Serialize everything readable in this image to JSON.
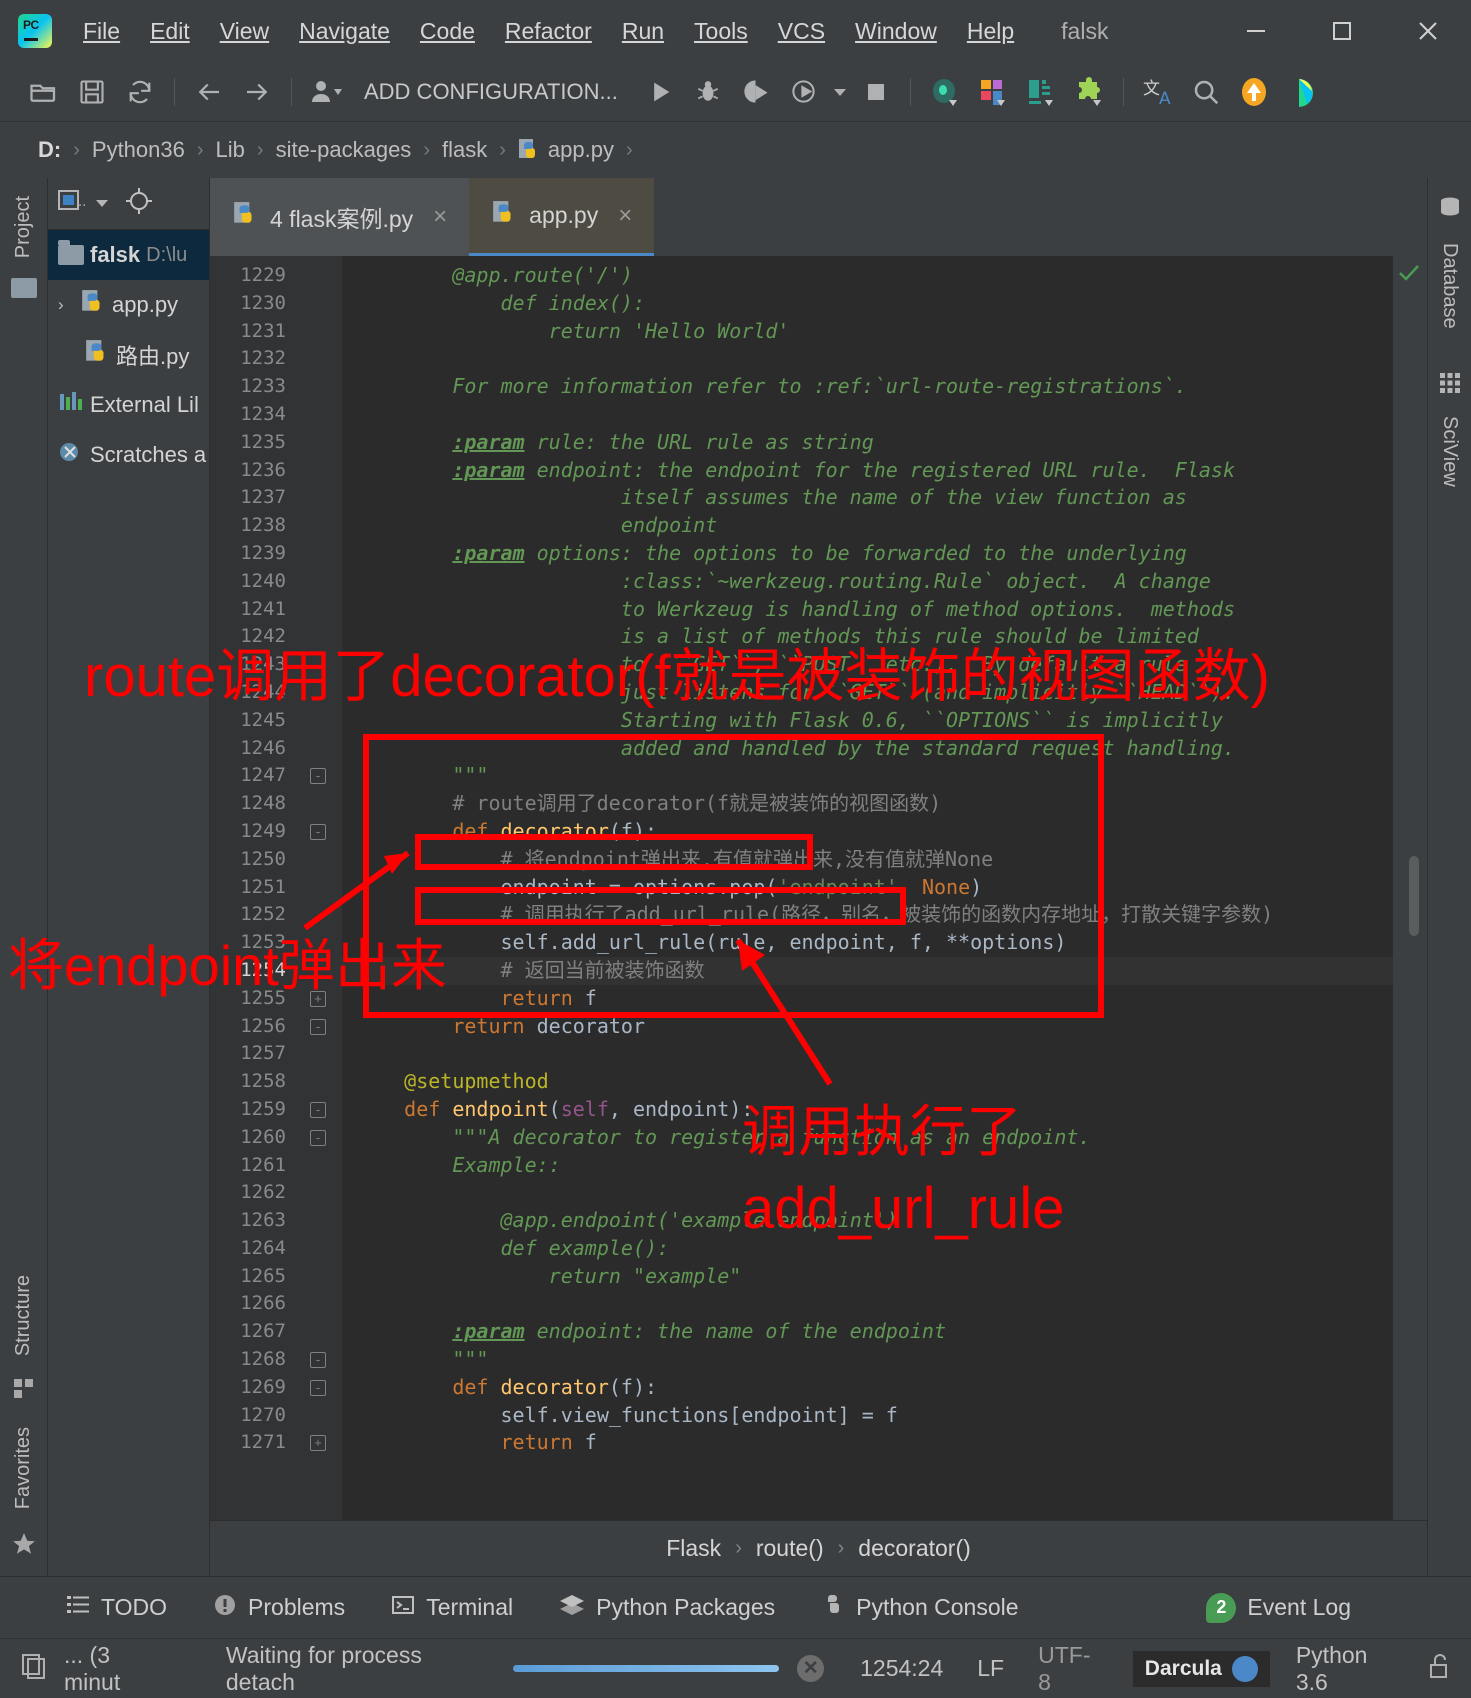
{
  "window": {
    "project_name": "falsk",
    "menu": [
      {
        "label": "File",
        "accel": "F"
      },
      {
        "label": "Edit",
        "accel": "E"
      },
      {
        "label": "View",
        "accel": "V"
      },
      {
        "label": "Navigate",
        "accel": "N"
      },
      {
        "label": "Code",
        "accel": "C"
      },
      {
        "label": "Refactor",
        "accel": "R"
      },
      {
        "label": "Run",
        "accel": "u"
      },
      {
        "label": "Tools",
        "accel": "T"
      },
      {
        "label": "VCS",
        "accel": "S"
      },
      {
        "label": "Window",
        "accel": "W"
      },
      {
        "label": "Help",
        "accel": "H"
      }
    ],
    "controls": {
      "minimize": "minimize-icon",
      "maximize": "maximize-icon",
      "close": "close-icon"
    }
  },
  "toolbar": {
    "run_config_label": "ADD CONFIGURATION...",
    "icons": [
      "open-folder-icon",
      "save-icon",
      "sync-icon",
      "back-arrow-icon",
      "forward-arrow-icon",
      "profile-dropdown-icon",
      "run-icon",
      "debug-icon",
      "run-with-coverage-icon",
      "profile-run-icon",
      "stop-icon",
      "search-everywhere-icon",
      "layout-icon",
      "data-view-icon",
      "plugins-icon",
      "translate-icon",
      "magnifier-icon",
      "update-icon",
      "ide-features-icon"
    ]
  },
  "breadcrumb": {
    "items": [
      "D:",
      "Python36",
      "Lib",
      "site-packages",
      "flask",
      "app.py"
    ]
  },
  "project_panel": {
    "title": "Project",
    "toolbar_icons": [
      "project-view-selector-icon",
      "scroll-from-source-icon"
    ],
    "tree": [
      {
        "name": "falsk",
        "path": "D:\\lu",
        "type": "folder",
        "selected": true,
        "bold": true
      },
      {
        "name": "app.py",
        "path": "",
        "type": "python",
        "arrow": "›"
      },
      {
        "name": "路由.py",
        "path": "",
        "type": "python"
      },
      {
        "name": "External Lil",
        "path": "",
        "type": "library"
      },
      {
        "name": "Scratches a",
        "path": "",
        "type": "scratch"
      }
    ]
  },
  "left_strip": {
    "tabs": [
      "Project",
      "Structure",
      "Favorites"
    ]
  },
  "right_strip": {
    "tabs": [
      "Database",
      "SciView"
    ]
  },
  "tabs": [
    {
      "label": "4 flask案例.py",
      "active": false,
      "close": "×"
    },
    {
      "label": "app.py",
      "active": true,
      "close": "×"
    }
  ],
  "editor": {
    "first_line": 1229,
    "current_line": 1254,
    "lines": [
      {
        "n": 1229,
        "html": "        <span class='doc'>@app.route('/')</span>"
      },
      {
        "n": 1230,
        "html": "            <span class='doc'>def index():</span>"
      },
      {
        "n": 1231,
        "html": "                <span class='doc'>return 'Hello World'</span>"
      },
      {
        "n": 1232,
        "html": ""
      },
      {
        "n": 1233,
        "html": "        <span class='doc'>For more information refer to :ref:`url-route-registrations`.</span>"
      },
      {
        "n": 1234,
        "html": ""
      },
      {
        "n": 1235,
        "html": "        <span class='docp'>:param</span><span class='doc'> rule: the URL rule as string</span>"
      },
      {
        "n": 1236,
        "html": "        <span class='docp'>:param</span><span class='doc'> endpoint: the endpoint for the registered URL rule.  Flask</span>"
      },
      {
        "n": 1237,
        "html": "                      <span class='doc'>itself assumes the name of the view function as</span>"
      },
      {
        "n": 1238,
        "html": "                      <span class='doc'>endpoint</span>"
      },
      {
        "n": 1239,
        "html": "        <span class='docp'>:param</span><span class='doc'> options: the options to be forwarded to the underlying</span>"
      },
      {
        "n": 1240,
        "html": "                      <span class='doc'>:class:`~werkzeug.routing.Rule` object.  A change</span>"
      },
      {
        "n": 1241,
        "html": "                      <span class='doc'>to Werkzeug is handling of method options.  methods</span>"
      },
      {
        "n": 1242,
        "html": "                      <span class='doc'>is a list of methods this rule should be limited</span>"
      },
      {
        "n": 1243,
        "html": "                      <span class='doc'>to (``GET``, ``POST`` etc.).  By default a rule</span>"
      },
      {
        "n": 1244,
        "html": "                      <span class='doc'>just listens for ``GET`` (and implicitly ``HEAD``).</span>"
      },
      {
        "n": 1245,
        "html": "                      <span class='doc'>Starting with Flask 0.6, ``OPTIONS`` is implicitly</span>"
      },
      {
        "n": 1246,
        "html": "                      <span class='doc'>added and handled by the standard request handling.</span>"
      },
      {
        "n": 1247,
        "html": "        <span class='doc'>\"\"\"</span>"
      },
      {
        "n": 1248,
        "html": "        <span class='cmt'># route调用了decorator(f就是被装饰的视图函数)</span>"
      },
      {
        "n": 1249,
        "html": "        <span class='kw'>def </span><span class='fn'>decorator</span>(f):"
      },
      {
        "n": 1250,
        "html": "            <span class='cmt'># 将endpoint弹出来,有值就弹出来,没有值就弹None</span>"
      },
      {
        "n": 1251,
        "html": "            endpoint = options.pop(<span class='str'>'endpoint'</span>, <span class='kw'>None</span>)"
      },
      {
        "n": 1252,
        "html": "            <span class='cmt'># 调用执行了add_url_rule(路径，别名，被装饰的函数内存地址，打散关键字参数)</span>"
      },
      {
        "n": 1253,
        "html": "            self.add_url_rule(rule, endpoint, f, **options)"
      },
      {
        "n": 1254,
        "html": "            <span class='cmt'># 返回当前被装饰函数</span>"
      },
      {
        "n": 1255,
        "html": "            <span class='kw'>return </span>f"
      },
      {
        "n": 1256,
        "html": "        <span class='kw'>return </span>decorator"
      },
      {
        "n": 1257,
        "html": ""
      },
      {
        "n": 1258,
        "html": "    <span class='deco'>@setupmethod</span>"
      },
      {
        "n": 1259,
        "html": "    <span class='kw'>def </span><span class='fn'>endpoint</span>(<span class='selfk'>self</span>, endpoint):"
      },
      {
        "n": 1260,
        "html": "        <span class='doc'>\"\"\"A decorator to register a function as an endpoint.</span>"
      },
      {
        "n": 1261,
        "html": "        <span class='doc'>Example::</span>"
      },
      {
        "n": 1262,
        "html": ""
      },
      {
        "n": 1263,
        "html": "            <span class='doc'>@app.endpoint('example.endpoint')</span>"
      },
      {
        "n": 1264,
        "html": "            <span class='doc'>def example():</span>"
      },
      {
        "n": 1265,
        "html": "                <span class='doc'>return \"example\"</span>"
      },
      {
        "n": 1266,
        "html": ""
      },
      {
        "n": 1267,
        "html": "        <span class='docp'>:param</span><span class='doc'> endpoint: the name of the endpoint</span>"
      },
      {
        "n": 1268,
        "html": "        <span class='doc'>\"\"\"</span>"
      },
      {
        "n": 1269,
        "html": "        <span class='kw'>def </span><span class='fn'>decorator</span>(f):"
      },
      {
        "n": 1270,
        "html": "            self.view_functions[endpoint] = f"
      },
      {
        "n": 1271,
        "html": "            <span class='kw'>return </span>f"
      }
    ]
  },
  "editor_breadcrumb": {
    "items": [
      "Flask",
      "route()",
      "decorator()"
    ]
  },
  "annotations": {
    "top": "route调用了decorator(f就是被装饰的视图函数)",
    "left": "将endpoint弹出来",
    "right_line1": "调用执行了",
    "right_line2": "add_url_rule",
    "color": "#ff0000"
  },
  "tool_windows": [
    {
      "label": "TODO",
      "icon": "todo-list-icon"
    },
    {
      "label": "Problems",
      "icon": "problems-icon"
    },
    {
      "label": "Terminal",
      "icon": "terminal-icon"
    },
    {
      "label": "Python Packages",
      "icon": "packages-icon"
    },
    {
      "label": "Python Console",
      "icon": "python-console-icon"
    },
    {
      "label": "Event Log",
      "icon": "event-log-icon",
      "badge": "2"
    }
  ],
  "status_bar": {
    "memory": "... (3 minut",
    "message": "Waiting for process detach",
    "caret": "1254:24",
    "line_sep": "LF",
    "encoding": "UTF-8",
    "theme": "Darcula",
    "interpreter": "Python 3.6",
    "lock_icon": "unlocked-icon"
  },
  "colors": {
    "accent": "#4a88c7",
    "annotation_red": "#ff0000",
    "green_badge": "#499c54",
    "panel_bg": "#3c3f41",
    "editor_bg": "#2b2b2b",
    "gutter_bg": "#313335"
  }
}
